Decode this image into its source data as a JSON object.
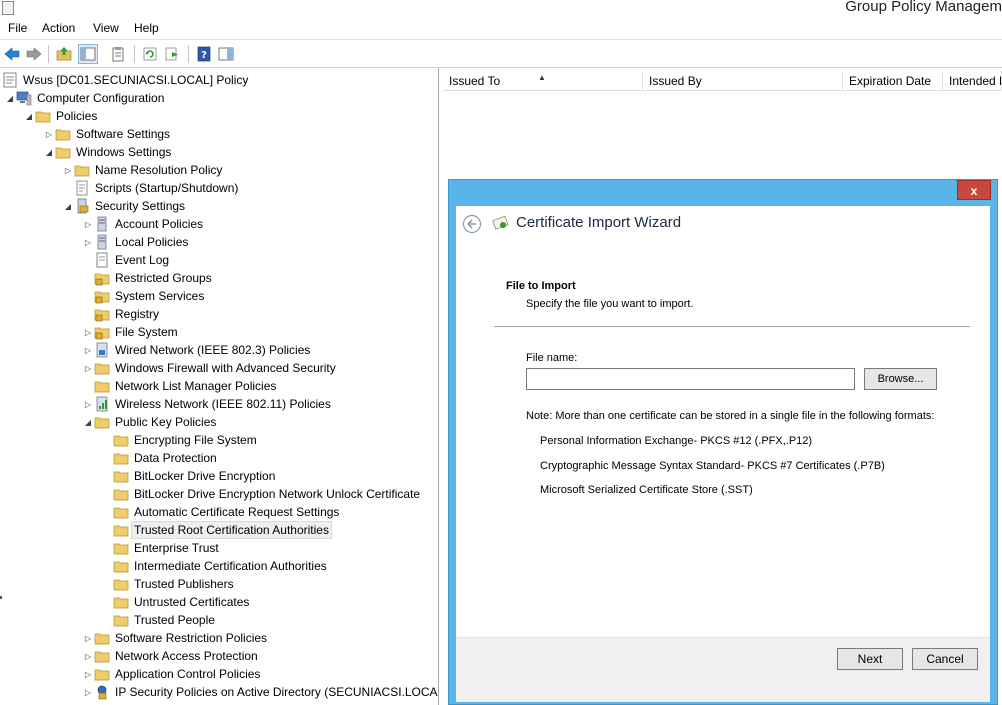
{
  "window": {
    "title": "Group Policy Managem"
  },
  "menu": [
    "File",
    "Action",
    "View",
    "Help"
  ],
  "toolbar": {
    "buttons": [
      "back-icon",
      "forward-icon",
      "up-folder-icon",
      "show-hide-tree-icon",
      "properties-icon",
      "refresh-icon",
      "export-list-icon",
      "help-icon",
      "action-pane-icon"
    ]
  },
  "tree": {
    "root": "Wsus [DC01.SECUNIACSI.LOCAL] Policy",
    "computer_configuration": "Computer Configuration",
    "policies": "Policies",
    "software_settings": "Software Settings",
    "windows_settings": "Windows Settings",
    "name_resolution_policy": "Name Resolution Policy",
    "scripts": "Scripts (Startup/Shutdown)",
    "security_settings": "Security Settings",
    "account_policies": "Account Policies",
    "local_policies": "Local Policies",
    "event_log": "Event Log",
    "restricted_groups": "Restricted Groups",
    "system_services": "System Services",
    "registry": "Registry",
    "file_system": "File System",
    "wired_network": "Wired Network (IEEE 802.3) Policies",
    "windows_firewall": "Windows Firewall with Advanced Security",
    "network_list_manager": "Network List Manager Policies",
    "wireless_network": "Wireless Network (IEEE 802.11) Policies",
    "public_key_policies": "Public Key Policies",
    "encrypting_file_system": "Encrypting File System",
    "data_protection": "Data Protection",
    "bitlocker": "BitLocker Drive Encryption",
    "bitlocker_network_unlock": "BitLocker Drive Encryption Network Unlock Certificate",
    "auto_cert_request": "Automatic Certificate Request Settings",
    "trusted_root": "Trusted Root Certification Authorities",
    "enterprise_trust": "Enterprise Trust",
    "intermediate_ca": "Intermediate Certification Authorities",
    "trusted_publishers": "Trusted Publishers",
    "untrusted_certificates": "Untrusted Certificates",
    "trusted_people": "Trusted People",
    "software_restriction": "Software Restriction Policies",
    "network_access_protection": "Network Access Protection",
    "application_control": "Application Control Policies",
    "ip_security": "IP Security Policies on Active Directory (SECUNIACSI.LOCAL)"
  },
  "list": {
    "columns": [
      "Issued To",
      "Issued By",
      "Expiration Date",
      "Intended P"
    ]
  },
  "wizard": {
    "close_label": "x",
    "title": "Certificate Import Wizard",
    "section_title": "File to Import",
    "section_subtitle": "Specify the file you want to import.",
    "file_name_label": "File name:",
    "file_name_value": "",
    "browse_label": "Browse...",
    "note": "Note:  More than one certificate can be stored in a single file in the following formats:",
    "formats": [
      "Personal Information Exchange- PKCS #12 (.PFX,.P12)",
      "Cryptographic Message Syntax Standard- PKCS #7 Certificates (.P7B)",
      "Microsoft Serialized Certificate Store (.SST)"
    ],
    "next_label": "Next",
    "cancel_label": "Cancel"
  }
}
